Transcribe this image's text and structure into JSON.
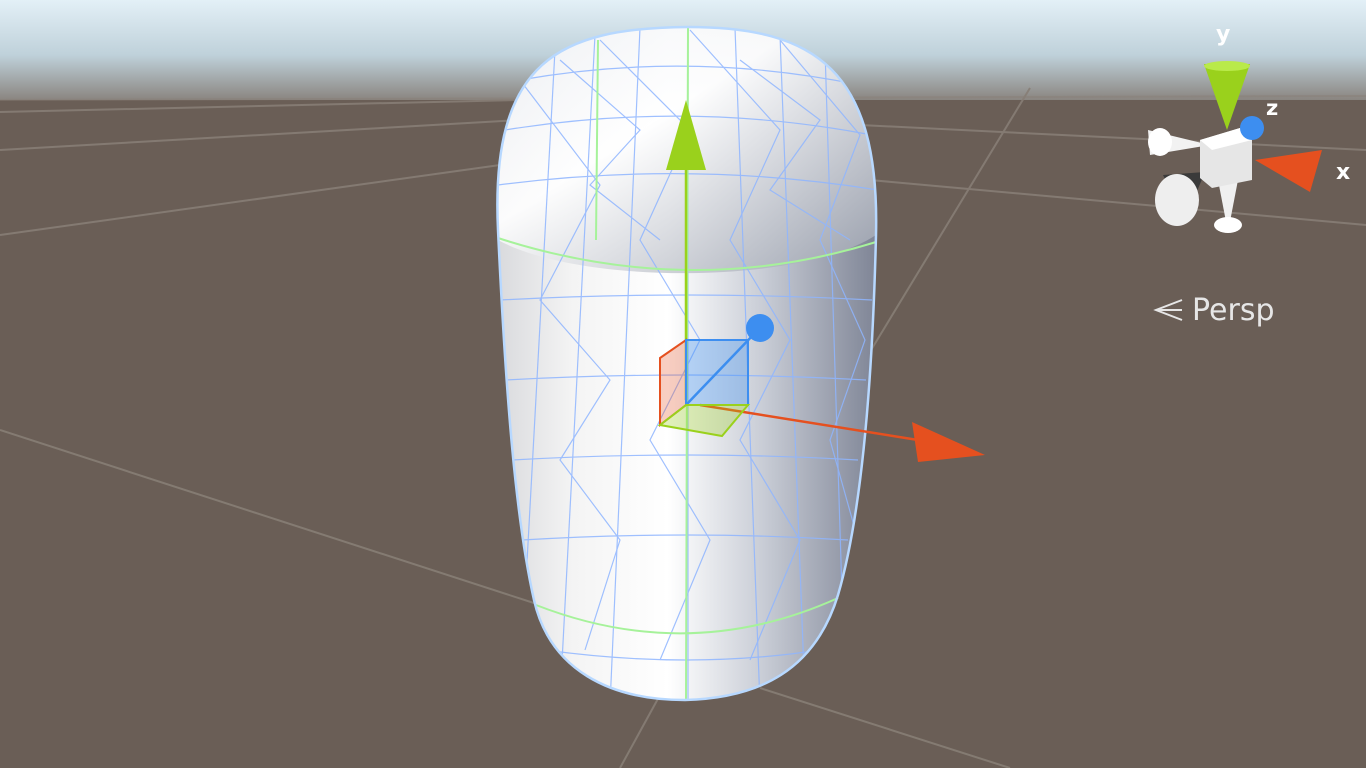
{
  "scene_view": {
    "projection_label": "Persp",
    "axis_labels": {
      "x": "x",
      "y": "y",
      "z": "z"
    }
  },
  "colors": {
    "ground": "#6a5e56",
    "sky_top": "#dfeef6",
    "x_axis": "#e5501f",
    "y_axis": "#9ad11c",
    "z_axis": "#3d8ef0",
    "wireframe": "#8fb5ff",
    "collider": "#a6f29a"
  },
  "icons": {
    "projection": "persp-chevron-icon",
    "orientation_gizmo": "scene-orientation-gizmo"
  }
}
